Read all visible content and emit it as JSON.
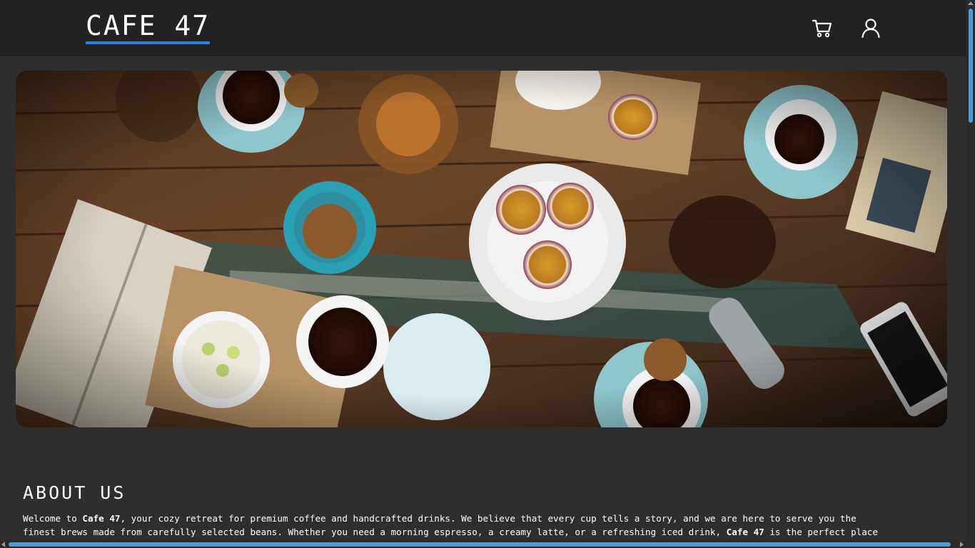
{
  "header": {
    "brand": "CAFE 47",
    "cart_icon": "cart-icon",
    "user_icon": "user-icon"
  },
  "hero": {
    "image": "overhead photo of wooden cafe table with coffee cups, cookies, passion fruit, book and phone"
  },
  "about": {
    "title": "ABOUT US",
    "line1_a": "Welcome to ",
    "line1_brand": "Cafe 47",
    "line1_b": ", your cozy retreat for premium coffee and handcrafted drinks. We believe that every cup tells a story, and we are here to serve you the",
    "line2_a": "finest brews made from carefully selected beans. Whether you need a morning espresso, a creamy latte, or a refreshing iced drink, ",
    "line2_brand": "Cafe 47",
    "line2_b": " is the perfect place"
  },
  "colors": {
    "accent": "#2f7ee6",
    "header_bg": "#222222",
    "page_bg": "#2e2e2e",
    "scrollbar_thumb": "#4d9ad8"
  }
}
